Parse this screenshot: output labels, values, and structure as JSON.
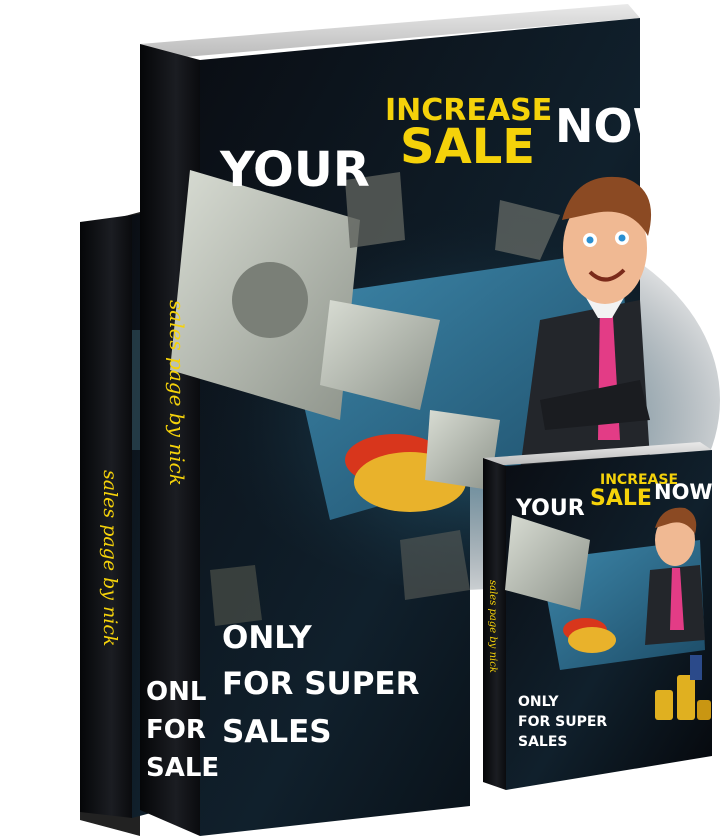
{
  "product": {
    "headline_small": "INCREASE",
    "headline_your": "YOUR",
    "headline_sale": "SALE",
    "headline_now": "NOW",
    "tagline_line1": "ONLY",
    "tagline_line2": "FOR SUPER",
    "tagline_line3": "SALES",
    "back_tagline_line1": "ONL",
    "back_tagline_line2": "FOR",
    "back_tagline_line3": "SALE",
    "spine_text": "sales page by nick"
  },
  "colors": {
    "cover_dark": "#0b0f16",
    "accent_yellow": "#f5d20a",
    "text_white": "#ffffff",
    "card_blue": "#2f6f8f",
    "coin_gold": "#e0b020"
  }
}
